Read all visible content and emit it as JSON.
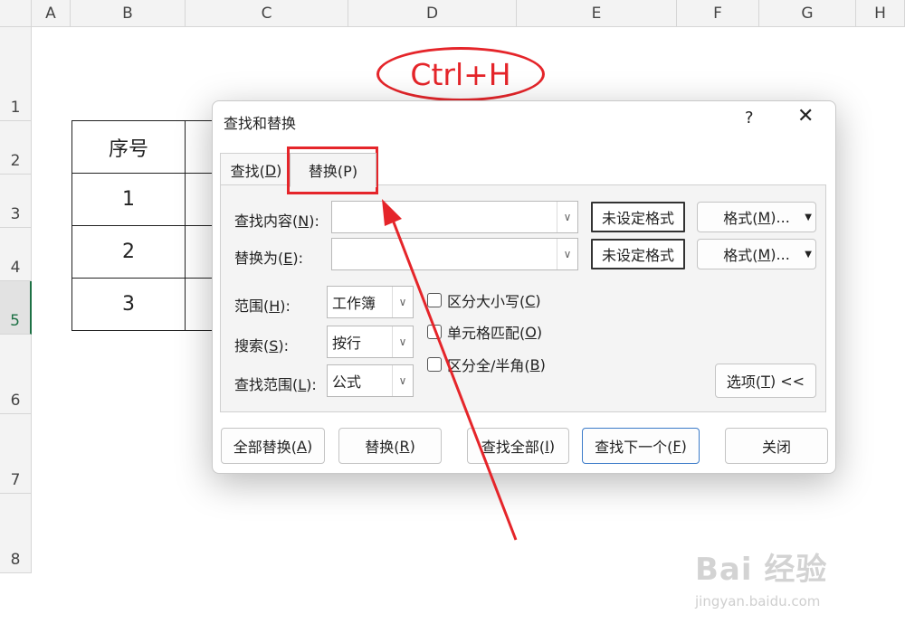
{
  "sheet": {
    "columns": [
      "A",
      "B",
      "C",
      "D",
      "E",
      "F",
      "G",
      "H"
    ],
    "rows": [
      "1",
      "2",
      "3",
      "4",
      "5",
      "6",
      "7",
      "8"
    ],
    "active_row": "5",
    "table": [
      [
        "序号"
      ],
      [
        "1"
      ],
      [
        "2"
      ],
      [
        "3"
      ]
    ]
  },
  "annotation": {
    "hotkey": "Ctrl+H",
    "color": "#e5252a"
  },
  "dialog": {
    "title": "查找和替换",
    "help": "?",
    "close": "✕",
    "tabs": {
      "find": {
        "label": "查找(",
        "key": "D",
        "suffix": ")"
      },
      "replace": {
        "label": "替换(P)"
      }
    },
    "find_what": {
      "label_pre": "查找内容(",
      "key": "N",
      "label_post": "):",
      "value": ""
    },
    "replace_with": {
      "label_pre": "替换为(",
      "key": "E",
      "label_post": "):",
      "value": ""
    },
    "format_preview": "未设定格式",
    "format_button": {
      "pre": "格式(",
      "key": "M",
      "post": ")..."
    },
    "within": {
      "label_pre": "范围(",
      "key": "H",
      "label_post": "):",
      "value": "工作簿"
    },
    "search": {
      "label_pre": "搜索(",
      "key": "S",
      "label_post": "):",
      "value": "按行"
    },
    "look_in": {
      "label_pre": "查找范围(",
      "key": "L",
      "label_post": "):",
      "value": "公式"
    },
    "options": [
      {
        "pre": "区分大小写(",
        "key": "C",
        "post": ")"
      },
      {
        "pre": "单元格匹配(",
        "key": "O",
        "post": ")"
      },
      {
        "pre": "区分全/半角(",
        "key": "B",
        "post": ")"
      }
    ],
    "options_button": {
      "pre": "选项(",
      "key": "T",
      "post": ") <<"
    },
    "buttons": {
      "replace_all": {
        "pre": "全部替换(",
        "key": "A",
        "post": ")"
      },
      "replace": {
        "pre": "替换(",
        "key": "R",
        "post": ")"
      },
      "find_all": {
        "pre": "查找全部(",
        "key": "I",
        "post": ")"
      },
      "find_next": {
        "pre": "查找下一个(",
        "key": "F",
        "post": ")"
      },
      "close": "关闭"
    }
  },
  "watermark": {
    "logo": "Bai 经验",
    "url": "jingyan.baidu.com"
  }
}
